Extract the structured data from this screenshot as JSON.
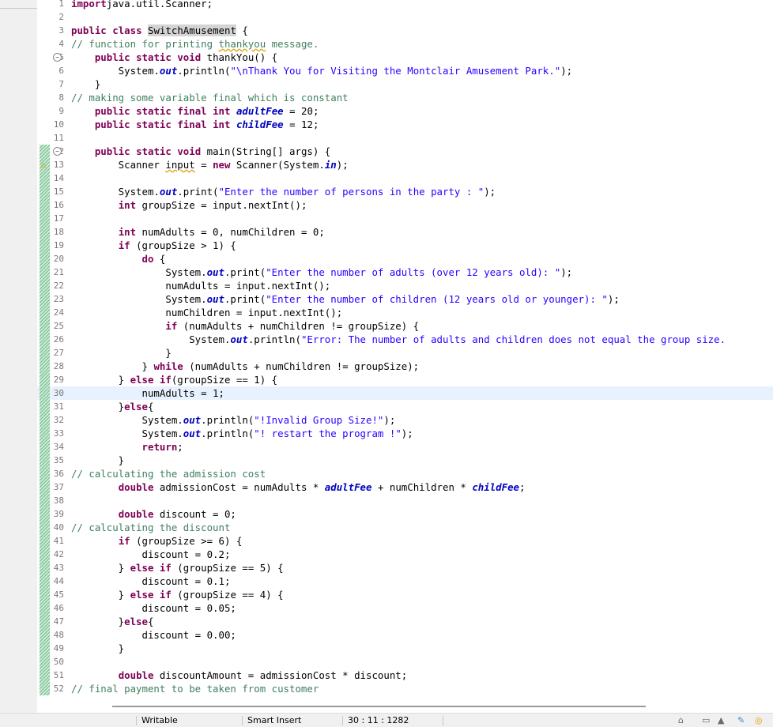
{
  "status": {
    "writable": "Writable",
    "insert_mode": "Smart Insert",
    "position": "30 : 11 : 1282"
  },
  "status_icons": [
    "hat-icon",
    "book-icon",
    "graduation-icon",
    "pencil-icon",
    "circle-icon"
  ],
  "current_line": 30,
  "lines": [
    {
      "n": "1",
      "tokens": [
        [
          "kw",
          "import"
        ],
        [
          "",
          "java.util.Scanner;"
        ]
      ]
    },
    {
      "n": "2",
      "tokens": []
    },
    {
      "n": "3",
      "tokens": [
        [
          "kw",
          "public"
        ],
        [
          "",
          " "
        ],
        [
          "kw",
          "class"
        ],
        [
          "",
          " "
        ],
        [
          "hl",
          "SwitchAmusement"
        ],
        [
          "",
          " {"
        ]
      ]
    },
    {
      "n": "4",
      "tokens": [
        [
          "cm",
          "// function for printing "
        ],
        [
          "cmsq",
          "thankyou"
        ],
        [
          "cm",
          " message."
        ]
      ]
    },
    {
      "n": "5",
      "tokens": [
        [
          "",
          "    "
        ],
        [
          "kw",
          "public"
        ],
        [
          "",
          " "
        ],
        [
          "kw",
          "static"
        ],
        [
          "",
          " "
        ],
        [
          "kw",
          "void"
        ],
        [
          "",
          " thankYou() {"
        ]
      ]
    },
    {
      "n": "6",
      "tokens": [
        [
          "",
          "        System."
        ],
        [
          "sfld",
          "out"
        ],
        [
          "",
          ".println("
        ],
        [
          "str",
          "\"\\nThank You for Visiting the Montclair Amusement Park.\""
        ],
        [
          "",
          ");"
        ]
      ]
    },
    {
      "n": "7",
      "tokens": [
        [
          "",
          "    }"
        ]
      ]
    },
    {
      "n": "8",
      "tokens": [
        [
          "cm",
          "// making some variable final which is constant"
        ]
      ]
    },
    {
      "n": "9",
      "tokens": [
        [
          "",
          "    "
        ],
        [
          "kw",
          "public"
        ],
        [
          "",
          " "
        ],
        [
          "kw",
          "static"
        ],
        [
          "",
          " "
        ],
        [
          "kw",
          "final"
        ],
        [
          "",
          " "
        ],
        [
          "kw",
          "int"
        ],
        [
          "",
          " "
        ],
        [
          "sfld",
          "adultFee"
        ],
        [
          "",
          " = 20;"
        ]
      ]
    },
    {
      "n": "10",
      "tokens": [
        [
          "",
          "    "
        ],
        [
          "kw",
          "public"
        ],
        [
          "",
          " "
        ],
        [
          "kw",
          "static"
        ],
        [
          "",
          " "
        ],
        [
          "kw",
          "final"
        ],
        [
          "",
          " "
        ],
        [
          "kw",
          "int"
        ],
        [
          "",
          " "
        ],
        [
          "sfld",
          "childFee"
        ],
        [
          "",
          " = 12;"
        ]
      ]
    },
    {
      "n": "11",
      "tokens": []
    },
    {
      "n": "12",
      "tokens": [
        [
          "",
          "    "
        ],
        [
          "kw",
          "public"
        ],
        [
          "",
          " "
        ],
        [
          "kw",
          "static"
        ],
        [
          "",
          " "
        ],
        [
          "kw",
          "void"
        ],
        [
          "",
          " main(String[] args) {"
        ]
      ]
    },
    {
      "n": "13",
      "tokens": [
        [
          "",
          "        Scanner "
        ],
        [
          "sq",
          "input"
        ],
        [
          "",
          " = "
        ],
        [
          "kw",
          "new"
        ],
        [
          "",
          " Scanner(System."
        ],
        [
          "sfld",
          "in"
        ],
        [
          "",
          ");"
        ]
      ]
    },
    {
      "n": "14",
      "tokens": []
    },
    {
      "n": "15",
      "tokens": [
        [
          "",
          "        System."
        ],
        [
          "sfld",
          "out"
        ],
        [
          "",
          ".print("
        ],
        [
          "str",
          "\"Enter the number of persons in the party : \""
        ],
        [
          "",
          ");"
        ]
      ]
    },
    {
      "n": "16",
      "tokens": [
        [
          "",
          "        "
        ],
        [
          "kw",
          "int"
        ],
        [
          "",
          " groupSize = input.nextInt();"
        ]
      ]
    },
    {
      "n": "17",
      "tokens": []
    },
    {
      "n": "18",
      "tokens": [
        [
          "",
          "        "
        ],
        [
          "kw",
          "int"
        ],
        [
          "",
          " numAdults = 0, numChildren = 0;"
        ]
      ]
    },
    {
      "n": "19",
      "tokens": [
        [
          "",
          "        "
        ],
        [
          "kw",
          "if"
        ],
        [
          "",
          " (groupSize > 1) {"
        ]
      ]
    },
    {
      "n": "20",
      "tokens": [
        [
          "",
          "            "
        ],
        [
          "kw",
          "do"
        ],
        [
          "",
          " {"
        ]
      ]
    },
    {
      "n": "21",
      "tokens": [
        [
          "",
          "                System."
        ],
        [
          "sfld",
          "out"
        ],
        [
          "",
          ".print("
        ],
        [
          "str",
          "\"Enter the number of adults (over 12 years old): \""
        ],
        [
          "",
          ");"
        ]
      ]
    },
    {
      "n": "22",
      "tokens": [
        [
          "",
          "                numAdults = input.nextInt();"
        ]
      ]
    },
    {
      "n": "23",
      "tokens": [
        [
          "",
          "                System."
        ],
        [
          "sfld",
          "out"
        ],
        [
          "",
          ".print("
        ],
        [
          "str",
          "\"Enter the number of children (12 years old or younger): \""
        ],
        [
          "",
          ");"
        ]
      ]
    },
    {
      "n": "24",
      "tokens": [
        [
          "",
          "                numChildren = input.nextInt();"
        ]
      ]
    },
    {
      "n": "25",
      "tokens": [
        [
          "",
          "                "
        ],
        [
          "kw",
          "if"
        ],
        [
          "",
          " (numAdults + numChildren != groupSize) {"
        ]
      ]
    },
    {
      "n": "26",
      "tokens": [
        [
          "",
          "                    System."
        ],
        [
          "sfld",
          "out"
        ],
        [
          "",
          ".println("
        ],
        [
          "str",
          "\"Error: The number of adults and children does not equal the group size."
        ]
      ]
    },
    {
      "n": "27",
      "tokens": [
        [
          "",
          "                }"
        ]
      ]
    },
    {
      "n": "28",
      "tokens": [
        [
          "",
          "            } "
        ],
        [
          "kw",
          "while"
        ],
        [
          "",
          " (numAdults + numChildren != groupSize);"
        ]
      ]
    },
    {
      "n": "29",
      "tokens": [
        [
          "",
          "        } "
        ],
        [
          "kw",
          "else"
        ],
        [
          "",
          " "
        ],
        [
          "kw",
          "if"
        ],
        [
          "",
          "(groupSize == 1) {"
        ]
      ]
    },
    {
      "n": "30",
      "tokens": [
        [
          "",
          "            numAdults = 1;"
        ]
      ]
    },
    {
      "n": "31",
      "tokens": [
        [
          "",
          "        }"
        ],
        [
          "kw",
          "else"
        ],
        [
          "",
          "{"
        ]
      ]
    },
    {
      "n": "32",
      "tokens": [
        [
          "",
          "            System."
        ],
        [
          "sfld",
          "out"
        ],
        [
          "",
          ".println("
        ],
        [
          "str",
          "\"!Invalid Group Size!\""
        ],
        [
          "",
          ");"
        ]
      ]
    },
    {
      "n": "33",
      "tokens": [
        [
          "",
          "            System."
        ],
        [
          "sfld",
          "out"
        ],
        [
          "",
          ".println("
        ],
        [
          "str",
          "\"! restart the program !\""
        ],
        [
          "",
          ");"
        ]
      ]
    },
    {
      "n": "34",
      "tokens": [
        [
          "",
          "            "
        ],
        [
          "kw",
          "return"
        ],
        [
          "",
          ";"
        ]
      ]
    },
    {
      "n": "35",
      "tokens": [
        [
          "",
          "        }"
        ]
      ]
    },
    {
      "n": "36",
      "tokens": [
        [
          "cm",
          "// calculating the admission cost"
        ]
      ]
    },
    {
      "n": "37",
      "tokens": [
        [
          "",
          "        "
        ],
        [
          "kw",
          "double"
        ],
        [
          "",
          " admissionCost = numAdults * "
        ],
        [
          "sfld",
          "adultFee"
        ],
        [
          "",
          " + numChildren * "
        ],
        [
          "sfld",
          "childFee"
        ],
        [
          "",
          ";"
        ]
      ]
    },
    {
      "n": "38",
      "tokens": []
    },
    {
      "n": "39",
      "tokens": [
        [
          "",
          "        "
        ],
        [
          "kw",
          "double"
        ],
        [
          "",
          " discount = 0;"
        ]
      ]
    },
    {
      "n": "40",
      "tokens": [
        [
          "cm",
          "// calculating the discount"
        ]
      ]
    },
    {
      "n": "41",
      "tokens": [
        [
          "",
          "        "
        ],
        [
          "kw",
          "if"
        ],
        [
          "",
          " (groupSize >= 6) {"
        ]
      ]
    },
    {
      "n": "42",
      "tokens": [
        [
          "",
          "            discount = 0.2;"
        ]
      ]
    },
    {
      "n": "43",
      "tokens": [
        [
          "",
          "        } "
        ],
        [
          "kw",
          "else"
        ],
        [
          "",
          " "
        ],
        [
          "kw",
          "if"
        ],
        [
          "",
          " (groupSize == 5) {"
        ]
      ]
    },
    {
      "n": "44",
      "tokens": [
        [
          "",
          "            discount = 0.1;"
        ]
      ]
    },
    {
      "n": "45",
      "tokens": [
        [
          "",
          "        } "
        ],
        [
          "kw",
          "else"
        ],
        [
          "",
          " "
        ],
        [
          "kw",
          "if"
        ],
        [
          "",
          " (groupSize == 4) {"
        ]
      ]
    },
    {
      "n": "46",
      "tokens": [
        [
          "",
          "            discount = 0.05;"
        ]
      ]
    },
    {
      "n": "47",
      "tokens": [
        [
          "",
          "        }"
        ],
        [
          "kw",
          "else"
        ],
        [
          "",
          "{"
        ]
      ]
    },
    {
      "n": "48",
      "tokens": [
        [
          "",
          "            discount = 0.00;"
        ]
      ]
    },
    {
      "n": "49",
      "tokens": [
        [
          "",
          "        }"
        ]
      ]
    },
    {
      "n": "50",
      "tokens": []
    },
    {
      "n": "51",
      "tokens": [
        [
          "",
          "        "
        ],
        [
          "kw",
          "double"
        ],
        [
          "",
          " discountAmount = admissionCost * discount;"
        ]
      ]
    },
    {
      "n": "52",
      "tokens": [
        [
          "cm",
          "// final payment to be taken from customer"
        ]
      ]
    }
  ]
}
